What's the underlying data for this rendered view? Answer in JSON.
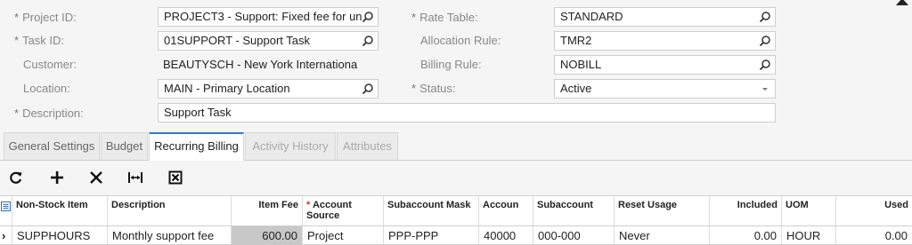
{
  "form": {
    "project_id": {
      "label": "Project ID:",
      "value": "PROJECT3 - Support: Fixed fee for un"
    },
    "task_id": {
      "label": "Task ID:",
      "value": "01SUPPORT - Support Task"
    },
    "customer": {
      "label": "Customer:",
      "value": "BEAUTYSCH - New York Internationa"
    },
    "location": {
      "label": "Location:",
      "value": "MAIN - Primary Location"
    },
    "description": {
      "label": "Description:",
      "value": "Support Task"
    },
    "rate_table": {
      "label": "Rate Table:",
      "value": "STANDARD"
    },
    "allocation_rule": {
      "label": "Allocation Rule:",
      "value": "TMR2"
    },
    "billing_rule": {
      "label": "Billing Rule:",
      "value": "NOBILL"
    },
    "status": {
      "label": "Status:",
      "value": "Active"
    },
    "required_mark": "*"
  },
  "tabs": [
    {
      "label": "General Settings"
    },
    {
      "label": "Budget"
    },
    {
      "label": "Recurring Billing"
    },
    {
      "label": "Activity History"
    },
    {
      "label": "Attributes"
    }
  ],
  "grid": {
    "headers": {
      "non_stock_item": "Non-Stock Item",
      "description": "Description",
      "item_fee": "Item Fee",
      "account_source": "Account Source",
      "subaccount_mask": "Subaccount Mask",
      "account": "Accoun",
      "subaccount": "Subaccount",
      "reset_usage": "Reset Usage",
      "included": "Included",
      "uom": "UOM",
      "used": "Used"
    },
    "rows": [
      {
        "non_stock_item": "SUPPHOURS",
        "description": "Monthly support fee",
        "item_fee": "600.00",
        "account_source": "Project",
        "subaccount_mask": "PPP-PPP",
        "account": "40000",
        "subaccount": "000-000",
        "reset_usage": "Never",
        "included": "0.00",
        "uom": "HOUR",
        "used": "0.00"
      }
    ]
  },
  "icons": {
    "lookup": "search-icon",
    "dropdown": "chevron-down-icon",
    "refresh": "refresh-icon",
    "add": "plus-icon",
    "delete": "close-icon",
    "fit": "fit-columns-icon",
    "export": "excel-export-icon"
  }
}
